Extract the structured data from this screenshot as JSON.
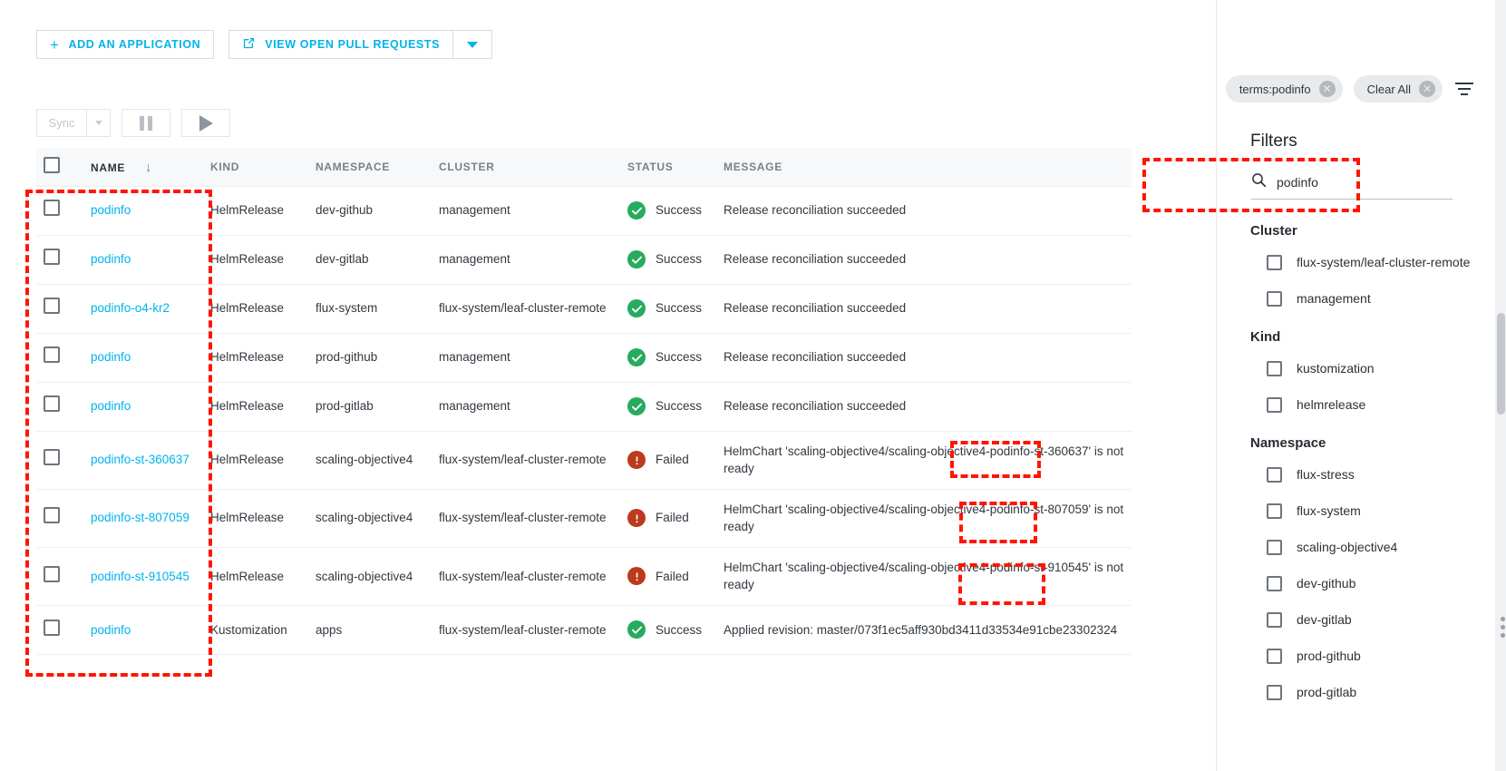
{
  "toolbar": {
    "add_application_label": "ADD AN APPLICATION",
    "view_prs_label": "VIEW OPEN PULL REQUESTS",
    "plus_icon": "plus-icon",
    "external_link_icon": "external-link-icon",
    "caret_icon": "chevron-down-icon"
  },
  "sync_toolbar": {
    "sync_label": "Sync",
    "sync_caret_icon": "chevron-down-icon",
    "pause_icon": "pause-icon",
    "play_icon": "play-icon"
  },
  "table": {
    "headers": {
      "name": "NAME",
      "kind": "KIND",
      "namespace": "NAMESPACE",
      "cluster": "CLUSTER",
      "status": "STATUS",
      "message": "MESSAGE",
      "sort_arrow": "↓"
    },
    "rows": [
      {
        "name": "podinfo",
        "kind": "HelmRelease",
        "namespace": "dev-github",
        "cluster": "management",
        "status": "Success",
        "status_type": "ok",
        "message": "Release reconciliation succeeded"
      },
      {
        "name": "podinfo",
        "kind": "HelmRelease",
        "namespace": "dev-gitlab",
        "cluster": "management",
        "status": "Success",
        "status_type": "ok",
        "message": "Release reconciliation succeeded"
      },
      {
        "name": "podinfo-o4-kr2",
        "kind": "HelmRelease",
        "namespace": "flux-system",
        "cluster": "flux-system/leaf-cluster-remote",
        "status": "Success",
        "status_type": "ok",
        "message": "Release reconciliation succeeded"
      },
      {
        "name": "podinfo",
        "kind": "HelmRelease",
        "namespace": "prod-github",
        "cluster": "management",
        "status": "Success",
        "status_type": "ok",
        "message": "Release reconciliation succeeded"
      },
      {
        "name": "podinfo",
        "kind": "HelmRelease",
        "namespace": "prod-gitlab",
        "cluster": "management",
        "status": "Success",
        "status_type": "ok",
        "message": "Release reconciliation succeeded"
      },
      {
        "name": "podinfo-st-360637",
        "kind": "HelmRelease",
        "namespace": "scaling-objective4",
        "cluster": "flux-system/leaf-cluster-remote",
        "status": "Failed",
        "status_type": "fail",
        "message": "HelmChart 'scaling-objective4/scaling-objective4-podinfo-st-360637' is not ready"
      },
      {
        "name": "podinfo-st-807059",
        "kind": "HelmRelease",
        "namespace": "scaling-objective4",
        "cluster": "flux-system/leaf-cluster-remote",
        "status": "Failed",
        "status_type": "fail",
        "message": "HelmChart 'scaling-objective4/scaling-objective4-podinfo-st-807059' is not ready"
      },
      {
        "name": "podinfo-st-910545",
        "kind": "HelmRelease",
        "namespace": "scaling-objective4",
        "cluster": "flux-system/leaf-cluster-remote",
        "status": "Failed",
        "status_type": "fail",
        "message": "HelmChart 'scaling-objective4/scaling-objective4-podinfo-st-910545' is not ready"
      },
      {
        "name": "podinfo",
        "kind": "Kustomization",
        "namespace": "apps",
        "cluster": "flux-system/leaf-cluster-remote",
        "status": "Success",
        "status_type": "ok",
        "message": "Applied revision: master/073f1ec5aff930bd3411d33534e91cbe23302324"
      }
    ]
  },
  "panel": {
    "chips": [
      {
        "label": "terms:podinfo",
        "close_icon": "close-circle-icon"
      },
      {
        "label": "Clear All",
        "close_icon": "close-circle-icon"
      }
    ],
    "filter_icon": "filter-icon",
    "title": "Filters",
    "search": {
      "icon": "search-icon",
      "value": "podinfo",
      "placeholder": ""
    },
    "facets": [
      {
        "title": "Cluster",
        "options": [
          {
            "label": "flux-system/leaf-cluster-remote",
            "checked": false
          },
          {
            "label": "management",
            "checked": false
          }
        ]
      },
      {
        "title": "Kind",
        "options": [
          {
            "label": "kustomization",
            "checked": false
          },
          {
            "label": "helmrelease",
            "checked": false
          }
        ]
      },
      {
        "title": "Namespace",
        "options": [
          {
            "label": "flux-stress",
            "checked": false
          },
          {
            "label": "flux-system",
            "checked": false
          },
          {
            "label": "scaling-objective4",
            "checked": false
          },
          {
            "label": "dev-github",
            "checked": false
          },
          {
            "label": "dev-gitlab",
            "checked": false
          },
          {
            "label": "prod-github",
            "checked": false
          },
          {
            "label": "prod-gitlab",
            "checked": false
          }
        ]
      }
    ]
  },
  "colors": {
    "accent": "#00b3ec",
    "success": "#27ab5f",
    "failure": "#bc3b1d",
    "annotation": "#ff1500"
  }
}
